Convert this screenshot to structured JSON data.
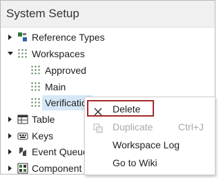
{
  "panel": {
    "title": "System Setup"
  },
  "tree": {
    "reference_types": "Reference Types",
    "workspaces": "Workspaces",
    "approved": "Approved",
    "main": "Main",
    "verification": "Verificatio",
    "table": "Table",
    "keys": "Keys",
    "event_queue": "Event Queue",
    "component": "Component"
  },
  "context_menu": {
    "delete": {
      "label": "Delete",
      "icon": "x-icon"
    },
    "duplicate": {
      "label": "Duplicate",
      "shortcut": "Ctrl+J",
      "disabled": true,
      "icon": "duplicate-icon"
    },
    "workspace_log": {
      "label": "Workspace Log"
    },
    "go_to_wiki": {
      "label": "Go to Wiki"
    }
  },
  "colors": {
    "highlight_border": "#a12a2a",
    "selection": "#d6e8f7"
  }
}
